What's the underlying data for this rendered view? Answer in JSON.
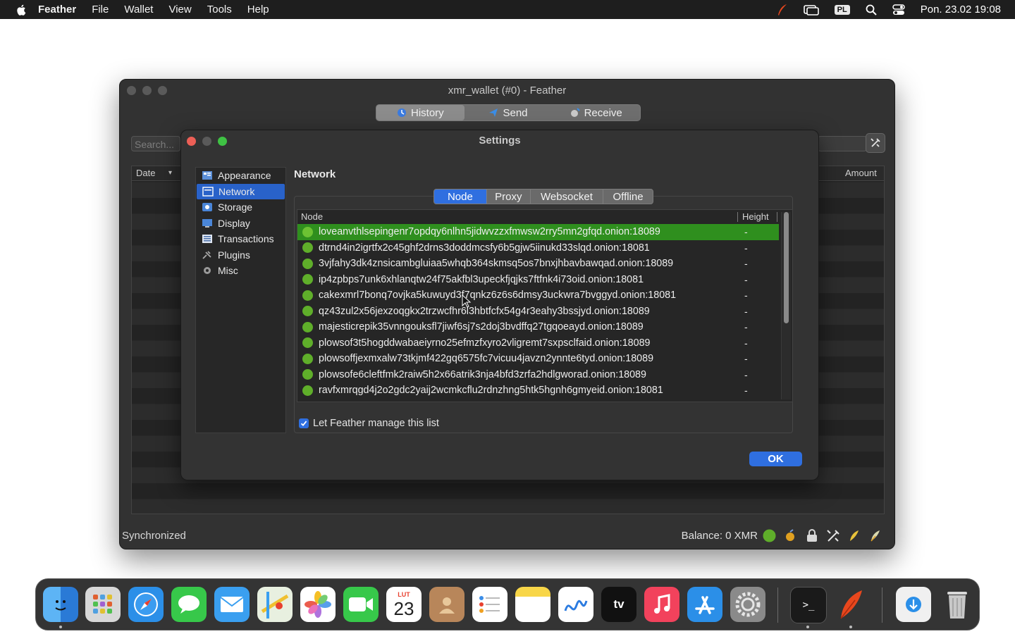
{
  "menubar": {
    "app_name": "Feather",
    "items": [
      "File",
      "Wallet",
      "View",
      "Tools",
      "Help"
    ],
    "input_source": "PL",
    "clock": "Pon. 23.02  19:08"
  },
  "main_window": {
    "title": "xmr_wallet (#0) - Feather",
    "tabs": [
      {
        "label": "History",
        "icon": "history-icon"
      },
      {
        "label": "Send",
        "icon": "send-icon"
      },
      {
        "label": "Receive",
        "icon": "receive-icon"
      }
    ],
    "search_placeholder": "Search...",
    "history_columns": {
      "date": "Date",
      "amount": "Amount"
    },
    "status": "Synchronized",
    "balance": "Balance: 0 XMR"
  },
  "settings": {
    "title": "Settings",
    "categories": [
      {
        "label": "Appearance",
        "icon": "appearance-icon"
      },
      {
        "label": "Network",
        "icon": "network-icon"
      },
      {
        "label": "Storage",
        "icon": "storage-icon"
      },
      {
        "label": "Display",
        "icon": "display-icon"
      },
      {
        "label": "Transactions",
        "icon": "transactions-icon"
      },
      {
        "label": "Plugins",
        "icon": "plugins-icon"
      },
      {
        "label": "Misc",
        "icon": "misc-icon"
      }
    ],
    "selected_category": "Network",
    "section_title": "Network",
    "network_tabs": [
      "Node",
      "Proxy",
      "Websocket",
      "Offline"
    ],
    "active_tab": "Node",
    "columns": {
      "node": "Node",
      "height": "Height"
    },
    "nodes": [
      {
        "address": "loveanvthlsepingenr7opdqy6nlhn5jidwvzzxfmwsw2rry5mn2gfqd.onion:18089",
        "height": "-"
      },
      {
        "address": "dtrnd4in2igrtfx2c45ghf2drns3doddmcsfy6b5gjw5iinukd33slqd.onion:18081",
        "height": "-"
      },
      {
        "address": "3vjfahy3dk4znsicambgluiaa5whqb364skmsq5os7bnxjhbavbawqad.onion:18089",
        "height": "-"
      },
      {
        "address": "ip4zpbps7unk6xhlanqtw24f75akfbl3upeckfjqjks7ftfnk4i73oid.onion:18081",
        "height": "-"
      },
      {
        "address": "cakexmrl7bonq7ovjka5kuwuyd3f7qnkz6z6s6dmsy3uckwra7bvggyd.onion:18081",
        "height": "-"
      },
      {
        "address": "qz43zul2x56jexzoqgkx2trzwcfhr6l3hbtfcfx54g4r3eahy3bssjyd.onion:18089",
        "height": "-"
      },
      {
        "address": "majesticrepik35vnngouksfl7jiwf6sj7s2doj3bvdffq27tgqoeayd.onion:18089",
        "height": "-"
      },
      {
        "address": "plowsof3t5hogddwabaeiyrno25efmzfxyro2vligremt7sxpsclfaid.onion:18089",
        "height": "-"
      },
      {
        "address": "plowsoffjexmxalw73tkjmf422gq6575fc7vicuu4javzn2ynnte6tyd.onion:18089",
        "height": "-"
      },
      {
        "address": "plowsofe6cleftfmk2raiw5h2x66atrik3nja4bfd3zrfa2hdlgworad.onion:18089",
        "height": "-"
      },
      {
        "address": "ravfxmrqgd4j2o2gdc2yaij2wcmkcflu2rdnzhng5htk5hgnh6gmyeid.onion:18081",
        "height": "-"
      }
    ],
    "selected_node_index": 0,
    "manage_checkbox": {
      "label": "Let Feather manage this list",
      "checked": true
    },
    "ok_label": "OK"
  },
  "dock": {
    "calendar_month": "LUT",
    "calendar_day": "23",
    "tv_label": "tv"
  },
  "colors": {
    "accent": "#2f6fe0",
    "selected_row": "#2f8f1e",
    "node_status": "#5fae2a"
  }
}
